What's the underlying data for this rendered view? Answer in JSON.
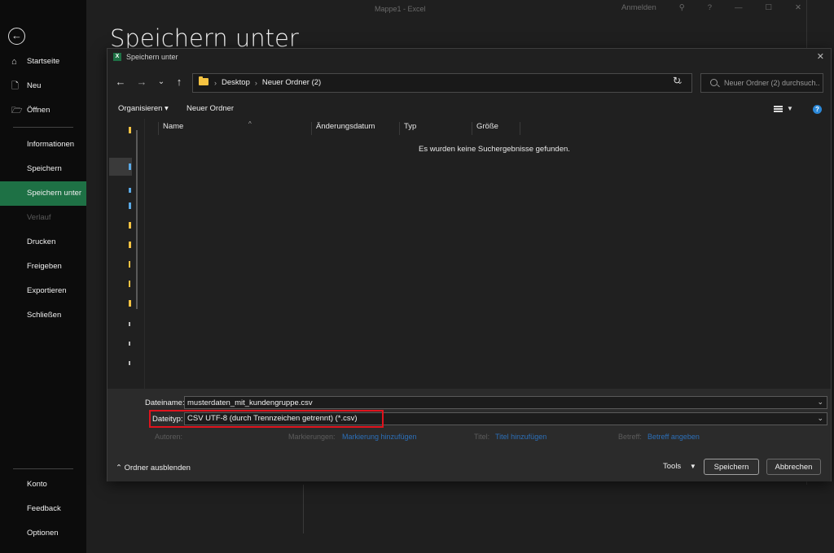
{
  "app": {
    "title": "Mappe1 - Excel",
    "signin": "Anmelden",
    "help": "?",
    "minimize": "—",
    "maximize": "☐",
    "close": "✕"
  },
  "backstage": {
    "heading": "Speichern unter",
    "nav_top": [
      {
        "label": "Startseite",
        "icon": "⌂"
      },
      {
        "label": "Neu",
        "icon": "🗋"
      },
      {
        "label": "Öffnen",
        "icon": "🗁"
      }
    ],
    "nav_mid": [
      {
        "label": "Informationen"
      },
      {
        "label": "Speichern"
      },
      {
        "label": "Speichern unter"
      },
      {
        "label": "Verlauf"
      },
      {
        "label": "Drucken"
      },
      {
        "label": "Freigeben"
      },
      {
        "label": "Exportieren"
      },
      {
        "label": "Schließen"
      }
    ],
    "nav_bottom": [
      {
        "label": "Konto"
      },
      {
        "label": "Feedback"
      },
      {
        "label": "Optionen"
      }
    ]
  },
  "dialog": {
    "title": "Speichern unter",
    "xl_icon": "X",
    "breadcrumb": [
      "Desktop",
      "Neuer Ordner (2)"
    ],
    "search_placeholder": "Neuer Ordner (2) durchsuch...",
    "toolbar": {
      "organize": "Organisieren ▾",
      "new_folder": "Neuer Ordner"
    },
    "columns": [
      "Name",
      "Änderungsdatum",
      "Typ",
      "Größe"
    ],
    "empty_message": "Es wurden keine Suchergebnisse gefunden.",
    "filename_label": "Dateiname:",
    "filename_value": "musterdaten_mit_kundengruppe.csv",
    "filetype_label": "Dateityp:",
    "filetype_value": "CSV UTF-8 (durch Trennzeichen getrennt) (*.csv)",
    "meta": {
      "authors_label": "Autoren:",
      "tags_label": "Markierungen:",
      "tags_link": "Markierung hinzufügen",
      "title_label": "Titel:",
      "title_link": "Titel hinzufügen",
      "subject_label": "Betreff:",
      "subject_link": "Betreff angeben"
    },
    "hide_folders": "Ordner ausblenden",
    "tools": "Tools",
    "save_button": "Speichern",
    "cancel_button": "Abbrechen"
  },
  "colors": {
    "accent_green": "#1e7145",
    "highlight_red": "#e0131d",
    "link_blue": "#2c6fb8"
  }
}
